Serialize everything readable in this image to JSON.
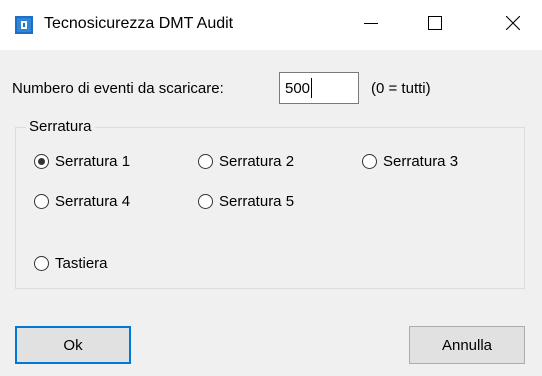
{
  "window": {
    "title": "Tecnosicurezza DMT Audit",
    "icon": "app-icon",
    "controls": [
      "minimize-icon",
      "maximize-icon",
      "close-icon"
    ]
  },
  "events": {
    "label": "Numbero di eventi da scaricare:",
    "value": "500",
    "hint": "(0 = tutti)"
  },
  "group": {
    "legend": "Serratura",
    "options": [
      {
        "label": "Serratura 1",
        "checked": true
      },
      {
        "label": "Serratura 2",
        "checked": false
      },
      {
        "label": "Serratura 3",
        "checked": false
      },
      {
        "label": "Serratura 4",
        "checked": false
      },
      {
        "label": "Serratura 5",
        "checked": false
      },
      {
        "label": "Tastiera",
        "checked": false
      }
    ]
  },
  "buttons": {
    "ok_label": "Ok",
    "cancel_label": "Annulla"
  },
  "colors": {
    "accent": "#0078d7",
    "background": "#f0f0f0",
    "titlebar": "#ffffff"
  }
}
